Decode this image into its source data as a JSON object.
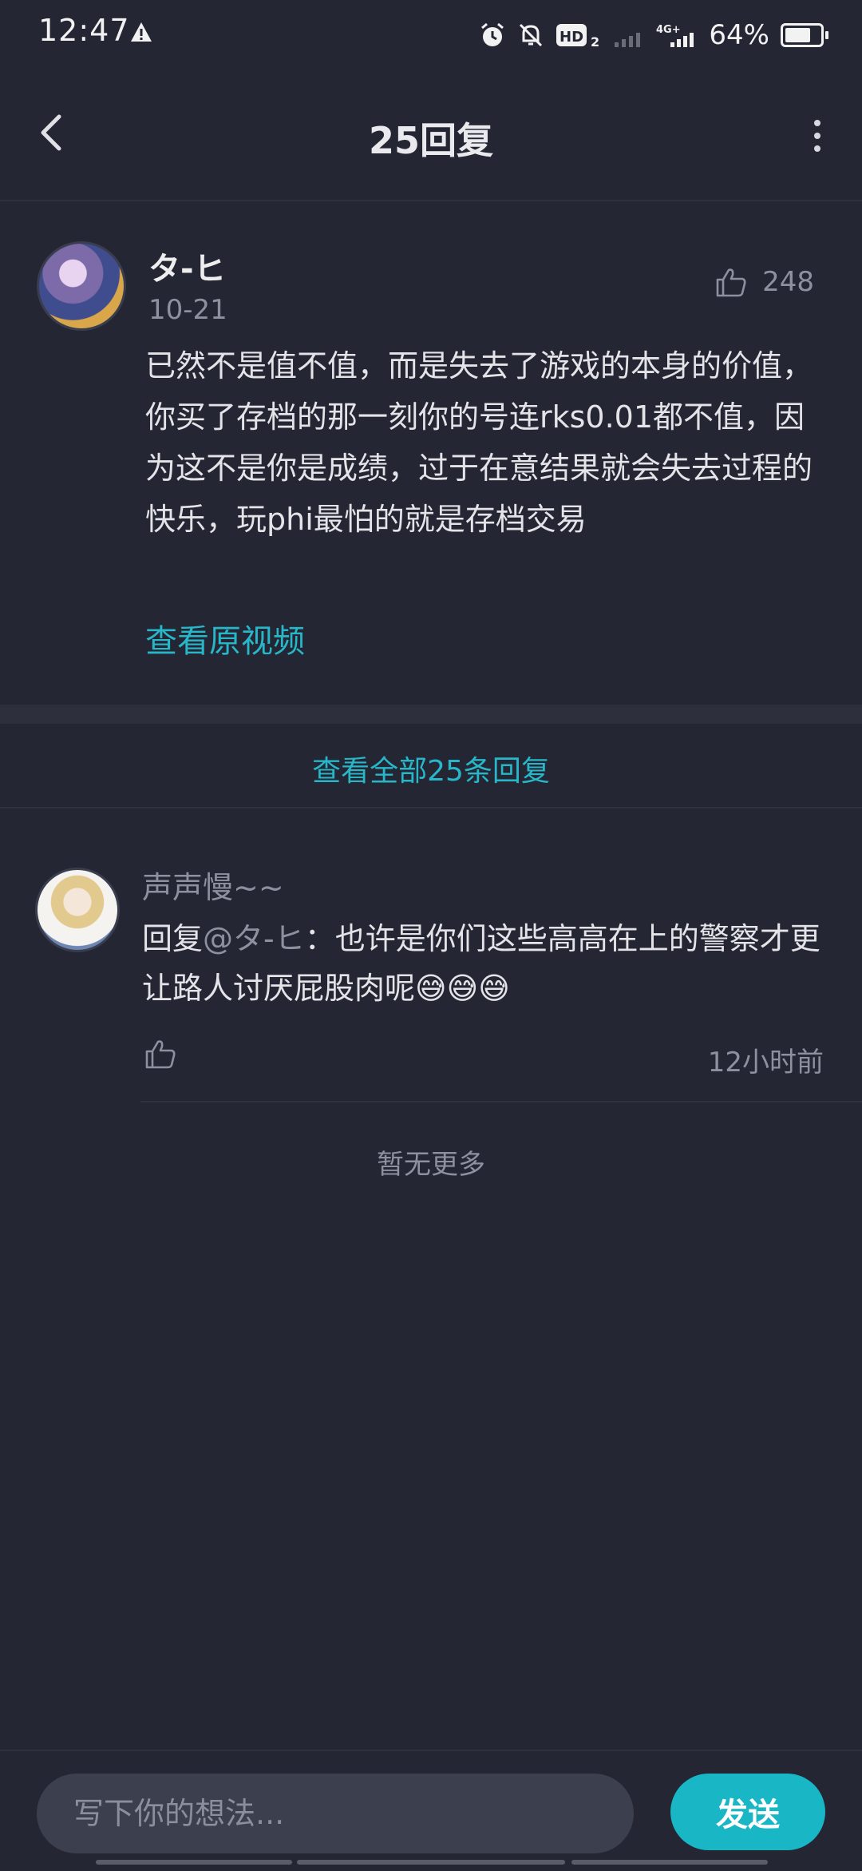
{
  "status_bar": {
    "time": "12:47",
    "battery": "64%",
    "battery_level": 0.64,
    "icons": [
      "warning-icon",
      "alarm-icon",
      "mute-icon",
      "hd-icon",
      "signal-icon",
      "4g-signal-icon",
      "battery-icon"
    ]
  },
  "header": {
    "title": "25回复",
    "back_icon": "chevron-left-icon",
    "more_icon": "more-vertical-icon"
  },
  "original_comment": {
    "username": "タ-ヒ",
    "date": "10-21",
    "likes": "248",
    "text": "已然不是值不值，而是失去了游戏的本身的价值，你买了存档的那一刻你的号连rks0.01都不值，因为这不是你是成绩，过于在意结果就会失去过程的快乐，玩phi最怕的就是存档交易",
    "view_video": "查看原视频"
  },
  "view_all_replies": "查看全部25条回复",
  "reply": {
    "username": "声声慢~~",
    "prefix": "回复",
    "mention": "@タ-ヒ",
    "text": "：也许是你们这些高高在上的警察才更让路人讨厌屁股肉呢😅😅😅",
    "time": "12小时前"
  },
  "no_more": "暂无更多",
  "input": {
    "placeholder": "写下你的想法...",
    "send_label": "发送"
  },
  "colors": {
    "background": "#242633",
    "accent": "#27b7c9",
    "send_button": "#19b6c6"
  }
}
